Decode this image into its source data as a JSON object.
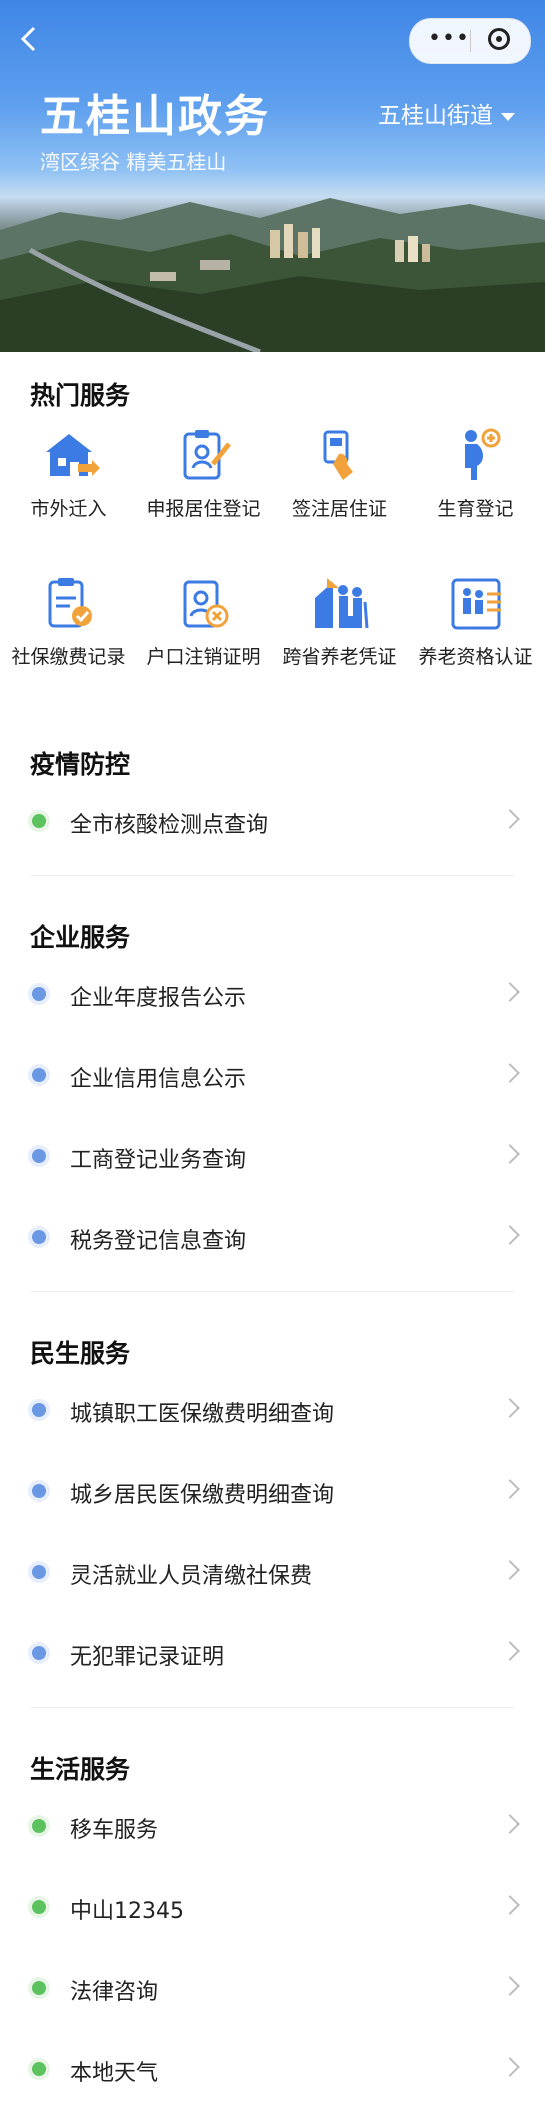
{
  "hero": {
    "title": "五桂山政务",
    "subtitle": "湾区绿谷 精美五桂山",
    "district": "五桂山街道"
  },
  "hot_services": {
    "title": "热门服务",
    "items": [
      {
        "label": "市外迁入",
        "icon": "house-arrow-icon"
      },
      {
        "label": "申报居住登记",
        "icon": "clipboard-pen-icon"
      },
      {
        "label": "签注居住证",
        "icon": "hand-card-icon"
      },
      {
        "label": "生育登记",
        "icon": "pregnant-woman-icon"
      },
      {
        "label": "社保缴费记录",
        "icon": "clipboard-check-icon"
      },
      {
        "label": "户口注销证明",
        "icon": "id-cancel-icon"
      },
      {
        "label": "跨省养老凭证",
        "icon": "elderly-home-icon"
      },
      {
        "label": "养老资格认证",
        "icon": "elderly-list-icon"
      }
    ]
  },
  "epidemic": {
    "title": "疫情防控",
    "items": [
      "全市核酸检测点查询"
    ]
  },
  "enterprise": {
    "title": "企业服务",
    "items": [
      "企业年度报告公示",
      "企业信用信息公示",
      "工商登记业务查询",
      "税务登记信息查询"
    ]
  },
  "livelihood": {
    "title": "民生服务",
    "items": [
      "城镇职工医保缴费明细查询",
      "城乡居民医保缴费明细查询",
      "灵活就业人员清缴社保费",
      "无犯罪记录证明"
    ]
  },
  "life": {
    "title": "生活服务",
    "items": [
      "移车服务",
      "中山12345",
      "法律咨询",
      "本地天气"
    ]
  },
  "colors": {
    "accent_blue": "#3b7be3",
    "icon_orange": "#f2a23a",
    "dot_green": "#5cc260",
    "dot_blue": "#6a98e3"
  }
}
